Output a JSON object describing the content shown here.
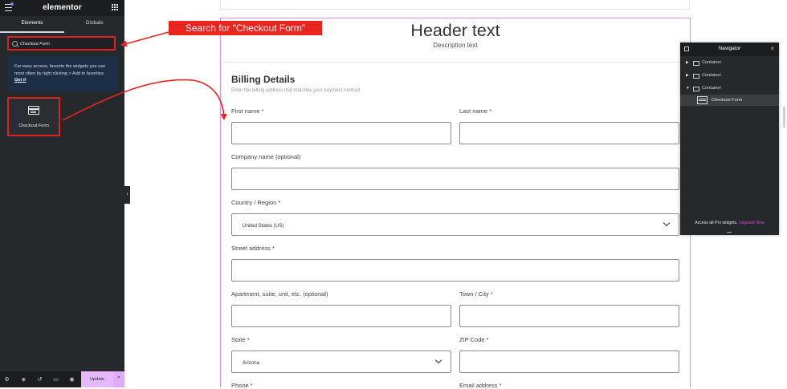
{
  "panel": {
    "logo": "elementor",
    "tabs": [
      "Elements",
      "Globals"
    ],
    "search_value": "Checkout Form",
    "promo_text": "For easy access, favorite the widgets you use most often by right clicking > Add to favorites.",
    "promo_link": "Get it",
    "widget_label": "Checkout Form",
    "update_label": "Update"
  },
  "annotation": {
    "callout": "Search for \"Checkout Form\""
  },
  "page": {
    "header_title": "Header text",
    "header_desc": "Description text",
    "billing_title": "Billing Details",
    "billing_sub": "Enter the billing address that matches your payment method.",
    "fields": {
      "first_name": "First name *",
      "last_name": "Last name *",
      "company": "Company name (optional)",
      "country": "Country / Region *",
      "country_value": "United States (US)",
      "street": "Street address *",
      "apartment": "Apartment, suite, unit, etc. (optional)",
      "town": "Town / City *",
      "state": "State *",
      "state_value": "Arizona",
      "zip": "ZIP Code *",
      "phone": "Phone *",
      "email": "Email address *"
    }
  },
  "navigator": {
    "title": "Navigator",
    "items": [
      "Container",
      "Container",
      "Container"
    ],
    "child": "Checkout Form",
    "footer_text": "Access all Pro widgets.",
    "footer_link": "Upgrade Now"
  },
  "colors": {
    "accent_red": "#e8251f",
    "panel_bg": "#26292c",
    "update_bg": "#e7b7ff",
    "page_border": "#d98fd9"
  }
}
